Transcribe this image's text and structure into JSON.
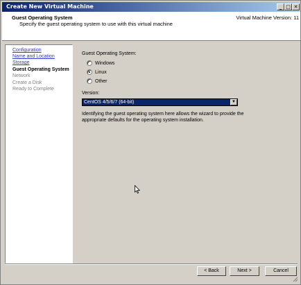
{
  "window": {
    "title": "Create New Virtual Machine",
    "controls": {
      "minimize": "_",
      "maximize": "□",
      "close": "✕"
    }
  },
  "header": {
    "title": "Guest Operating System",
    "subtitle": "Specify the guest operating system to use with this virtual machine",
    "version": "Virtual Machine Version: 11"
  },
  "nav": {
    "items": [
      {
        "label": "Configuration",
        "state": "link"
      },
      {
        "label": "Name and Location",
        "state": "link"
      },
      {
        "label": "Storage",
        "state": "link"
      },
      {
        "label": "Guest Operating System",
        "state": "current"
      },
      {
        "label": "Network",
        "state": "disabled"
      },
      {
        "label": "Create a Disk",
        "state": "disabled"
      },
      {
        "label": "Ready to Complete",
        "state": "disabled"
      }
    ]
  },
  "form": {
    "os_label": "Guest Operating System:",
    "os_options": [
      {
        "label": "Windows",
        "checked": false
      },
      {
        "label": "Linux",
        "checked": true
      },
      {
        "label": "Other",
        "checked": false
      }
    ],
    "version_label": "Version:",
    "version_value": "CentOS 4/5/6/7 (64-bit)",
    "description": "Identifying the guest operating system here allows the wizard to provide the appropriate defaults for the operating system installation."
  },
  "buttons": {
    "back": "< Back",
    "next": "Next >",
    "cancel": "Cancel"
  },
  "colors": {
    "titlebar_start": "#0a246a",
    "titlebar_end": "#a6caf0",
    "link": "#3333cc",
    "selection": "#0a246a",
    "chrome": "#d4d0c8"
  },
  "icons": {
    "cursor": "mouse-pointer-icon",
    "dropdown": "chevron-down-icon",
    "grip": "resize-grip-icon"
  }
}
